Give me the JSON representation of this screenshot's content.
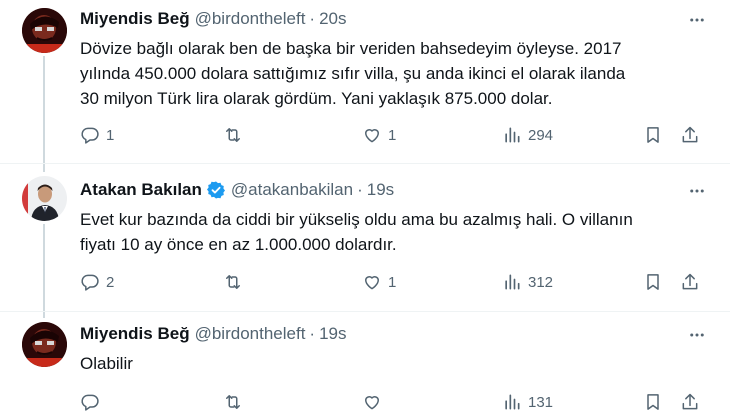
{
  "tweets": [
    {
      "author_name": "Miyendis Beğ",
      "handle": "@birdontheleft",
      "separator": "·",
      "time": "20s",
      "verified": false,
      "text_lines": [
        "Dövize bağlı olarak ben de başka bir veriden bahsedeyim öyleyse. 2017",
        "yılında 450.000 dolara sattığımız sıfır villa, şu anda ikinci el olarak ilanda",
        "30 milyon Türk lira olarak gördüm. Yani yaklaşık 875.000 dolar."
      ],
      "replies": "1",
      "retweets": "",
      "likes": "1",
      "views": "294"
    },
    {
      "author_name": "Atakan Bakılan",
      "handle": "@atakanbakilan",
      "separator": "·",
      "time": "19s",
      "verified": true,
      "text_lines": [
        "Evet kur bazında da ciddi bir yükseliş oldu ama bu azalmış hali. O villanın",
        "fiyatı 10 ay önce en az 1.000.000 dolardır."
      ],
      "replies": "2",
      "retweets": "",
      "likes": "1",
      "views": "312"
    },
    {
      "author_name": "Miyendis Beğ",
      "handle": "@birdontheleft",
      "separator": "·",
      "time": "19s",
      "verified": false,
      "text_lines": [
        "Olabilir"
      ],
      "replies": "",
      "retweets": "",
      "likes": "",
      "views": "131"
    }
  ],
  "colors": {
    "text": "#0f1419",
    "secondary": "#536471",
    "verified_blue": "#1d9bf0",
    "thread_line": "#cfd9de"
  },
  "icons": {
    "reply": "reply-icon",
    "retweet": "retweet-icon",
    "like": "heart-icon",
    "views": "views-icon",
    "bookmark": "bookmark-icon",
    "share": "share-icon",
    "more": "more-icon",
    "verified": "verified-badge-icon"
  }
}
